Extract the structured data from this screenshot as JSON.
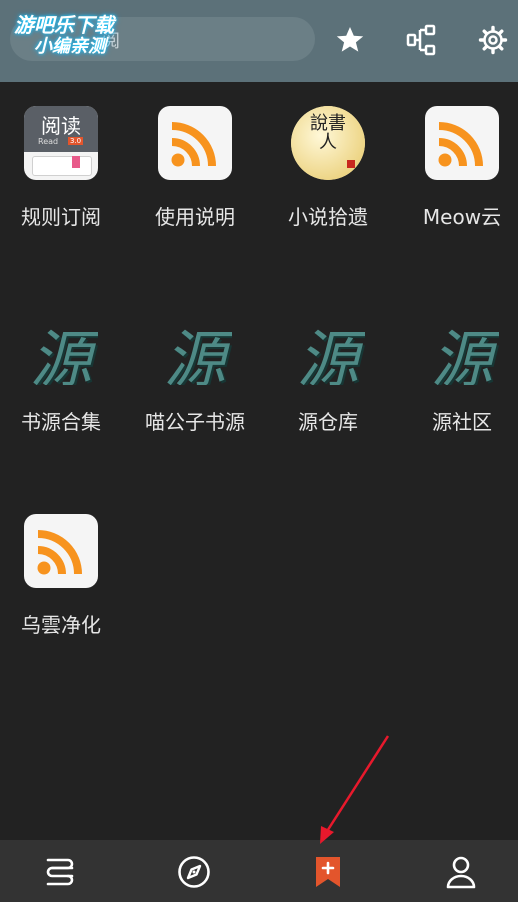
{
  "watermark": {
    "line1": "游吧乐下载",
    "line2": "小编亲测"
  },
  "search": {
    "text": "阅"
  },
  "toolbar": {
    "icons": [
      "star-icon",
      "group-icon",
      "gear-icon"
    ]
  },
  "sources": [
    {
      "name": "规则订阅",
      "icon": "reading-app-icon",
      "badge_main": "阅读",
      "badge_sub": "Read",
      "badge_version": "3.0"
    },
    {
      "name": "使用说明",
      "icon": "rss-icon"
    },
    {
      "name": "小说拾遗",
      "icon": "storyteller-icon",
      "badge_main": "說書人"
    },
    {
      "name": "Meow云",
      "icon": "rss-icon"
    },
    {
      "name": "书源合集",
      "icon": "yuan-calligraphy-icon",
      "glyph": "源"
    },
    {
      "name": "喵公子书源",
      "icon": "yuan-calligraphy-icon",
      "glyph": "源"
    },
    {
      "name": "源仓库",
      "icon": "yuan-calligraphy-icon",
      "glyph": "源"
    },
    {
      "name": "源社区",
      "icon": "yuan-calligraphy-icon",
      "glyph": "源"
    },
    {
      "name": "乌雲净化",
      "icon": "rss-icon"
    }
  ],
  "bottom_nav": [
    {
      "name": "bookshelf",
      "icon": "bookshelf-icon",
      "active": false
    },
    {
      "name": "discover",
      "icon": "compass-icon",
      "active": false
    },
    {
      "name": "subscription",
      "icon": "bookmark-plus-icon",
      "active": true
    },
    {
      "name": "my",
      "icon": "person-icon",
      "active": false
    }
  ],
  "colors": {
    "accent": "#e3552c",
    "topbar": "#5c7179",
    "background": "#222222",
    "bottombar": "#333333",
    "rss_orange": "#f7931e",
    "annotation_arrow": "#e8192c"
  }
}
